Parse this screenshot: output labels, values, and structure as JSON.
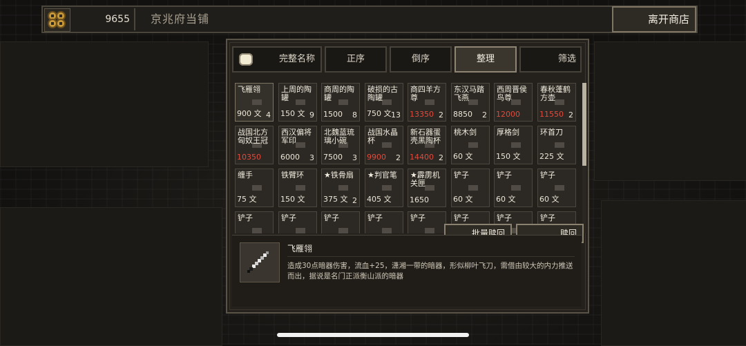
{
  "header": {
    "money": "9655",
    "shop_name": "京兆府当铺",
    "leave_label": "离开商店"
  },
  "tabs": [
    {
      "label": "完整名称",
      "active": false
    },
    {
      "label": "正序",
      "active": false
    },
    {
      "label": "倒序",
      "active": false
    },
    {
      "label": "整理",
      "active": true
    },
    {
      "label": "筛选",
      "active": false
    }
  ],
  "items": [
    {
      "name": "飞雁翎",
      "price": "900 文",
      "count": "4",
      "red": false
    },
    {
      "name": "上周的陶罐",
      "price": "150 文",
      "count": "9",
      "red": false
    },
    {
      "name": "商周的陶罐",
      "price": "1500",
      "count": "8",
      "red": false
    },
    {
      "name": "破损的古陶罐",
      "price": "750 文",
      "count": "13",
      "red": false
    },
    {
      "name": "商四羊方尊",
      "price": "13350",
      "count": "2",
      "red": true
    },
    {
      "name": "东汉马踏飞燕",
      "price": "8850",
      "count": "2",
      "red": false
    },
    {
      "name": "西周晋侯鸟尊",
      "price": "12000",
      "count": "",
      "red": true
    },
    {
      "name": "春秋蓬鹤方壶",
      "price": "11550",
      "count": "2",
      "red": true
    },
    {
      "name": "战国北方匈奴王冠",
      "price": "10350",
      "count": "",
      "red": true
    },
    {
      "name": "西汉偏将军印",
      "price": "6000",
      "count": "3",
      "red": false
    },
    {
      "name": "北魏蓝琉璃小碗",
      "price": "7500",
      "count": "3",
      "red": false
    },
    {
      "name": "战国水晶杯",
      "price": "9900",
      "count": "2",
      "red": true
    },
    {
      "name": "新石器蛋壳黑陶杯",
      "price": "14400",
      "count": "2",
      "red": true
    },
    {
      "name": "桃木剑",
      "price": "60 文",
      "count": "",
      "red": false
    },
    {
      "name": "厚格剑",
      "price": "150 文",
      "count": "",
      "red": false
    },
    {
      "name": "环首刀",
      "price": "225 文",
      "count": "",
      "red": false
    },
    {
      "name": "缠手",
      "price": "75 文",
      "count": "",
      "red": false
    },
    {
      "name": "铁臂环",
      "price": "150 文",
      "count": "",
      "red": false
    },
    {
      "name": "★铁骨扇",
      "price": "375 文",
      "count": "2",
      "red": false
    },
    {
      "name": "★判官笔",
      "price": "405 文",
      "count": "",
      "red": false
    },
    {
      "name": "★霹雳机关匣",
      "price": "1650",
      "count": "",
      "red": false
    },
    {
      "name": "铲子",
      "price": "60 文",
      "count": "",
      "red": false
    },
    {
      "name": "铲子",
      "price": "60 文",
      "count": "",
      "red": false
    },
    {
      "name": "铲子",
      "price": "60 文",
      "count": "",
      "red": false
    },
    {
      "name": "铲子",
      "price": "",
      "count": "",
      "red": false
    },
    {
      "name": "铲子",
      "price": "",
      "count": "",
      "red": false
    },
    {
      "name": "铲子",
      "price": "",
      "count": "",
      "red": false
    },
    {
      "name": "铲子",
      "price": "",
      "count": "",
      "red": false
    },
    {
      "name": "铲子",
      "price": "",
      "count": "",
      "red": false
    },
    {
      "name": "铲子",
      "price": "",
      "count": "",
      "red": false
    },
    {
      "name": "铲子",
      "price": "",
      "count": "",
      "red": false
    },
    {
      "name": "铲子",
      "price": "",
      "count": "",
      "red": false
    }
  ],
  "actions": {
    "batch_redeem": "批量赎回",
    "redeem": "赎回"
  },
  "detail": {
    "title": "飞雁翎",
    "description": "造成30点暗器伤害，流血+25，潇湘一带的暗器，形似柳叶飞刀，需借由较大的内力推送而出，据说是名门正派衡山派的暗器",
    "icon": "dagger-icon"
  },
  "colors": {
    "price_red": "#e24a3c",
    "panel_bg": "#24211d",
    "border": "#5a5347"
  }
}
